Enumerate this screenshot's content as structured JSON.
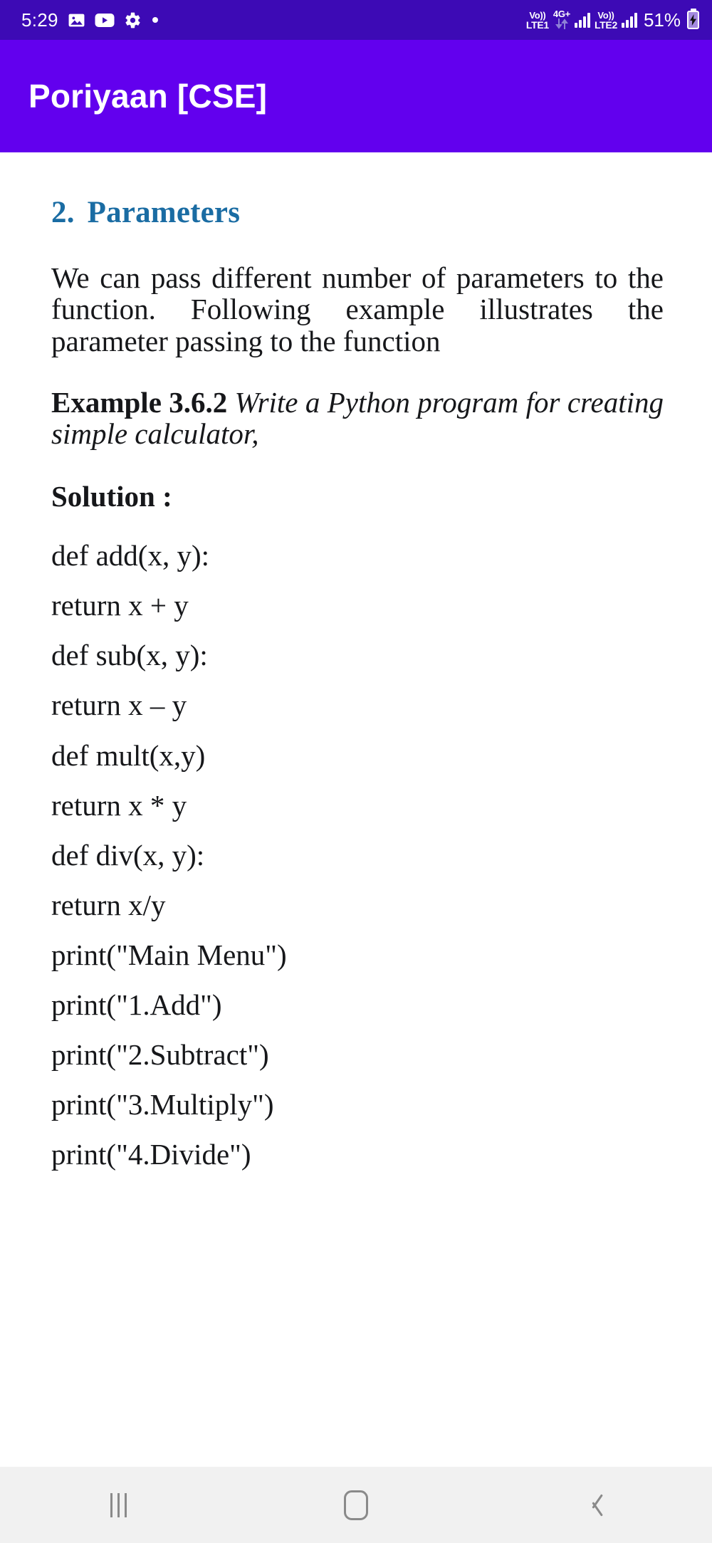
{
  "status_bar": {
    "time": "5:29",
    "left_icons": [
      "image-icon",
      "youtube-icon",
      "gear-icon",
      "dot-icon"
    ],
    "sim1": {
      "voice": "Vo))",
      "tech": "LTE1"
    },
    "network_type": "4G+",
    "sim2": {
      "voice": "Vo))",
      "tech": "LTE2"
    },
    "battery_percent": "51%",
    "background_color": "#3d0ab5"
  },
  "app_bar": {
    "title": "Poriyaan [CSE]",
    "background_color": "#6200ee",
    "text_color": "#ffffff"
  },
  "content": {
    "heading": {
      "number": "2.",
      "text": "Parameters",
      "color": "#1a6ca3"
    },
    "paragraph": "We can pass different number of parameters to the function. Following example illustrates the parameter passing to the function",
    "example": {
      "label": "Example 3.6.2",
      "italic_text": "Write a Python program for creating simple calculator,"
    },
    "solution_label": "Solution :",
    "code_lines": [
      "def add(x, y):",
      "return x + y",
      "def sub(x, y):",
      "return x – y",
      "def mult(x,y)",
      "return x * y",
      "def div(x, y):",
      "return x/y",
      "print(\"Main Menu\")",
      "print(\"1.Add\")",
      "print(\"2.Subtract\")",
      "print(\"3.Multiply\")",
      "print(\"4.Divide\")"
    ]
  },
  "nav_bar": {
    "recents_label": "recents-icon",
    "home_label": "home-icon",
    "back_label": "back-icon",
    "background_color": "#f1f1f1"
  }
}
